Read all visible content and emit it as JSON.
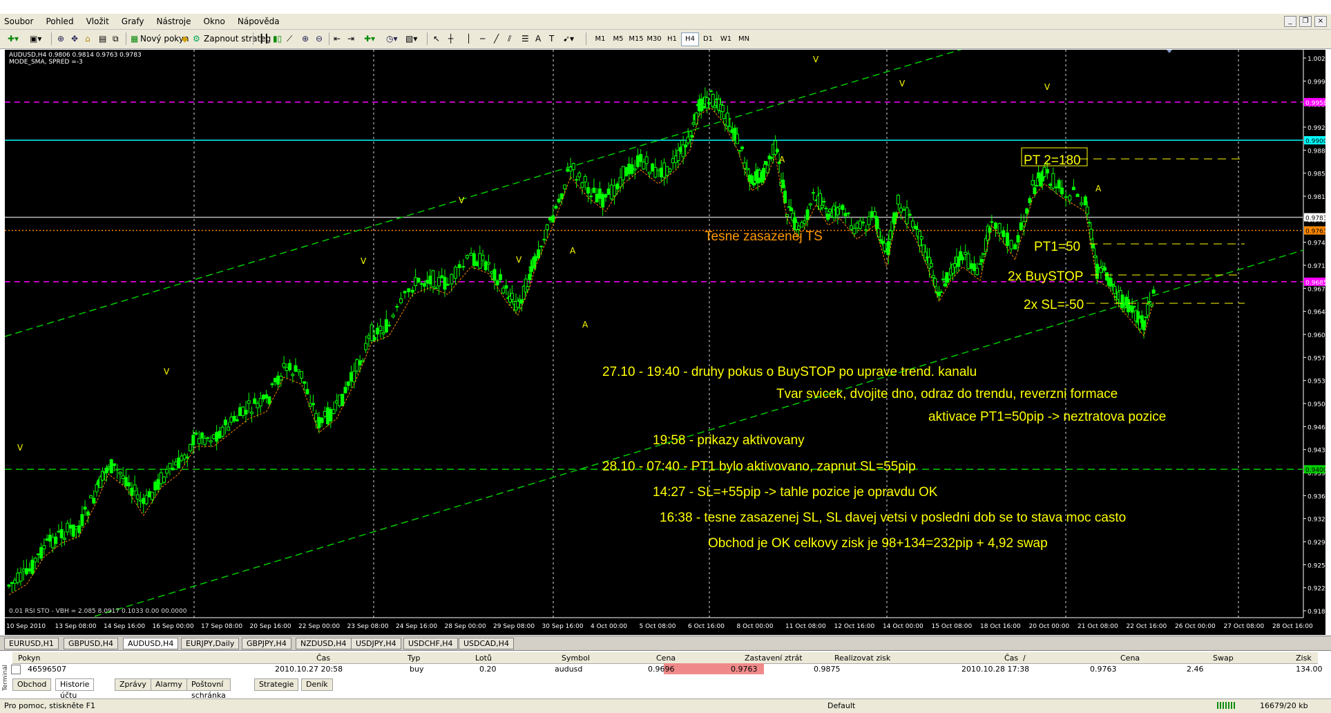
{
  "menu": [
    "Soubor",
    "Pohled",
    "Vložit",
    "Grafy",
    "Nástroje",
    "Okno",
    "Nápověda"
  ],
  "window_controls": [
    "_",
    "❐",
    "×"
  ],
  "toolbar": {
    "new_order": "Nový pokyn",
    "auto_strategy": "Zapnout strateg",
    "timeframes": [
      "M1",
      "M5",
      "M15",
      "M30",
      "H1",
      "H4",
      "D1",
      "W1",
      "MN"
    ],
    "active_timeframe": "H4"
  },
  "chart": {
    "header_line1": "AUDUSD,H4  0.9806 0.9814 0.9763 0.9783",
    "header_line2": "MODE_SMA, SPRED =-3",
    "indicator_label": "0.01 RSI STO - VBH = 2.085 8.0917 0.1033 0.00 00.0000",
    "price_axis": [
      "1.0025",
      "0.9990",
      "0.9955",
      "0.9920",
      "0.9885",
      "0.9850",
      "0.9815",
      "0.9780",
      "0.9745",
      "0.9710",
      "0.9675",
      "0.9640",
      "0.9605",
      "0.9570",
      "0.9535",
      "0.9500",
      "0.9465",
      "0.9430",
      "0.9395",
      "0.9360",
      "0.9325",
      "0.9290",
      "0.9255",
      "0.9220",
      "0.9185"
    ],
    "price_labels": {
      "magenta_top": "0.9958",
      "cyan": "0.9900",
      "current": "0.9783",
      "orange": "0.9763",
      "magenta_bottom": "0.9685",
      "green": "0.9400"
    },
    "time_axis": [
      "10 Sep 2010",
      "13 Sep 08:00",
      "14 Sep 16:00",
      "16 Sep 00:00",
      "17 Sep 08:00",
      "20 Sep 16:00",
      "22 Sep 00:00",
      "23 Sep 08:00",
      "24 Sep 16:00",
      "28 Sep 00:00",
      "29 Sep 08:00",
      "30 Sep 16:00",
      "4 Oct 00:00",
      "5 Oct 08:00",
      "6 Oct 16:00",
      "8 Oct 00:00",
      "11 Oct 08:00",
      "12 Oct 16:00",
      "14 Oct 00:00",
      "15 Oct 08:00",
      "18 Oct 16:00",
      "20 Oct 00:00",
      "21 Oct 08:00",
      "22 Oct 16:00",
      "26 Oct 00:00",
      "27 Oct 08:00",
      "28 Oct 16:00"
    ],
    "annotations": {
      "ts": "Tesne zasazenej TS",
      "pt2": "PT 2=180",
      "pt1": "PT1=50",
      "buystop": "2x BuySTOP",
      "sl": "2x SL=-50",
      "n1": "27.10 - 19:40 - druhy pokus o BuySTOP po uprave trend.  kanalu",
      "n2": "Tvar svicek, dvojite dno, odraz do trendu, reverzni formace",
      "n3": "aktivace PT1=50pip -> neztratova pozice",
      "n4": "19:58 - prikazy aktivovany",
      "n5": "28.10 - 07:40 - PT1 bylo aktivovano, zapnut SL=55pip",
      "n6": "14:27 - SL=+55pip -> tahle pozice je opravdu OK",
      "n7": "16:38 - tesne zasazenej SL, SL davej vetsi v posledni dob se  to stava moc casto",
      "n8": "Obchod je OK celkovy zisk je  98+134=232pip + 4,92 swap"
    },
    "marker_v": "V",
    "marker_a": "A"
  },
  "symbol_tabs": [
    "EURUSD,H1",
    "GBPUSD,H4",
    "AUDUSD,H4",
    "EURJPY,Daily",
    "GBPJPY,H4",
    "NZDUSD,H4",
    "USDJPY,H4",
    "USDCHF,H4",
    "USDCAD,H4"
  ],
  "active_symbol_tab": "AUDUSD,H4",
  "terminal": {
    "side_label": "Terminál",
    "headers": [
      "Pokyn",
      "Čas",
      "Typ",
      "Lotů",
      "Symbol",
      "Cena",
      "Zastavení ztrát",
      "Realizovat zisk",
      "Čas",
      "/",
      "Cena",
      "Swap",
      "Zisk"
    ],
    "row": [
      "46596507",
      "2010.10.27 20:58",
      "buy",
      "0.20",
      "audusd",
      "0.9696",
      "0.9763",
      "0.9875",
      "2010.10.28 17:38",
      "",
      "0.9763",
      "2.46",
      "134.00"
    ],
    "tabs": [
      "Obchod",
      "Historie účtu",
      "Zprávy",
      "Alarmy",
      "Poštovní schránka",
      "Strategie",
      "Deník"
    ],
    "active_tab": "Historie účtu"
  },
  "status": {
    "help": "Pro pomoc, stiskněte F1",
    "profile": "Default",
    "traffic": "16679/20 kb"
  },
  "colors": {
    "chart_bg": "#000000",
    "candle": "#00ff00",
    "annotation": "#ffff00",
    "ts_label": "#ff9900",
    "channel": "#00cc00",
    "magenta": "#ff00ff",
    "cyan": "#00ffff",
    "orange_line": "#ff8800"
  }
}
